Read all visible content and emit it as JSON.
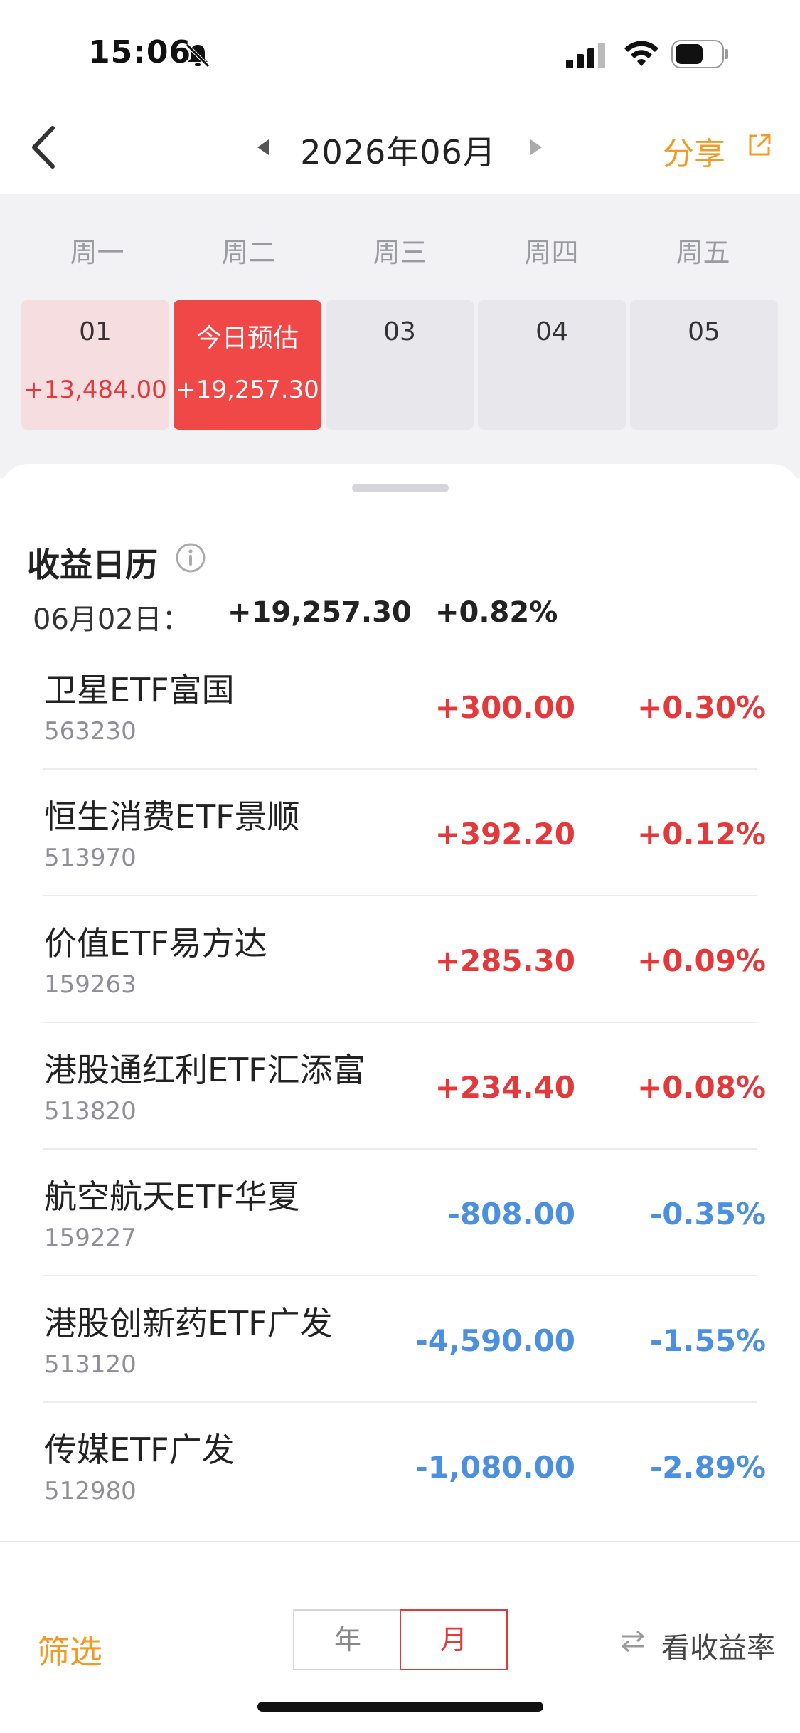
{
  "status_bar": {
    "time": "15:06"
  },
  "header": {
    "month_title": "2026年06月",
    "share_label": "分享"
  },
  "calendar": {
    "weekdays": [
      "周一",
      "周二",
      "周三",
      "周四",
      "周五"
    ],
    "days": [
      {
        "label": "01",
        "value": "+13,484.00"
      },
      {
        "label": "今日预估",
        "value": "+19,257.30"
      },
      {
        "label": "03",
        "value": ""
      },
      {
        "label": "04",
        "value": ""
      },
      {
        "label": "05",
        "value": ""
      }
    ]
  },
  "summary": {
    "title": "收益日历",
    "date": "06月02日：",
    "amount": "+19,257.30",
    "percent": "+0.82%"
  },
  "holdings": [
    {
      "name": "卫星ETF富国",
      "code": "563230",
      "amount": "+300.00",
      "percent": "+0.30%"
    },
    {
      "name": "恒生消费ETF景顺",
      "code": "513970",
      "amount": "+392.20",
      "percent": "+0.12%"
    },
    {
      "name": "价值ETF易方达",
      "code": "159263",
      "amount": "+285.30",
      "percent": "+0.09%"
    },
    {
      "name": "港股通红利ETF汇添富",
      "code": "513820",
      "amount": "+234.40",
      "percent": "+0.08%"
    },
    {
      "name": "航空航天ETF华夏",
      "code": "159227",
      "amount": "-808.00",
      "percent": "-0.35%"
    },
    {
      "name": "港股创新药ETF广发",
      "code": "513120",
      "amount": "-4,590.00",
      "percent": "-1.55%"
    },
    {
      "name": "传媒ETF广发",
      "code": "512980",
      "amount": "-1,080.00",
      "percent": "-2.89%"
    }
  ],
  "bottom_bar": {
    "filter_label": "筛选",
    "segment_year": "年",
    "segment_month": "月",
    "rate_toggle_label": "看收益率"
  },
  "colors": {
    "gain": "#e5383b",
    "loss": "#4b8fe0",
    "accent": "#f19a24"
  }
}
